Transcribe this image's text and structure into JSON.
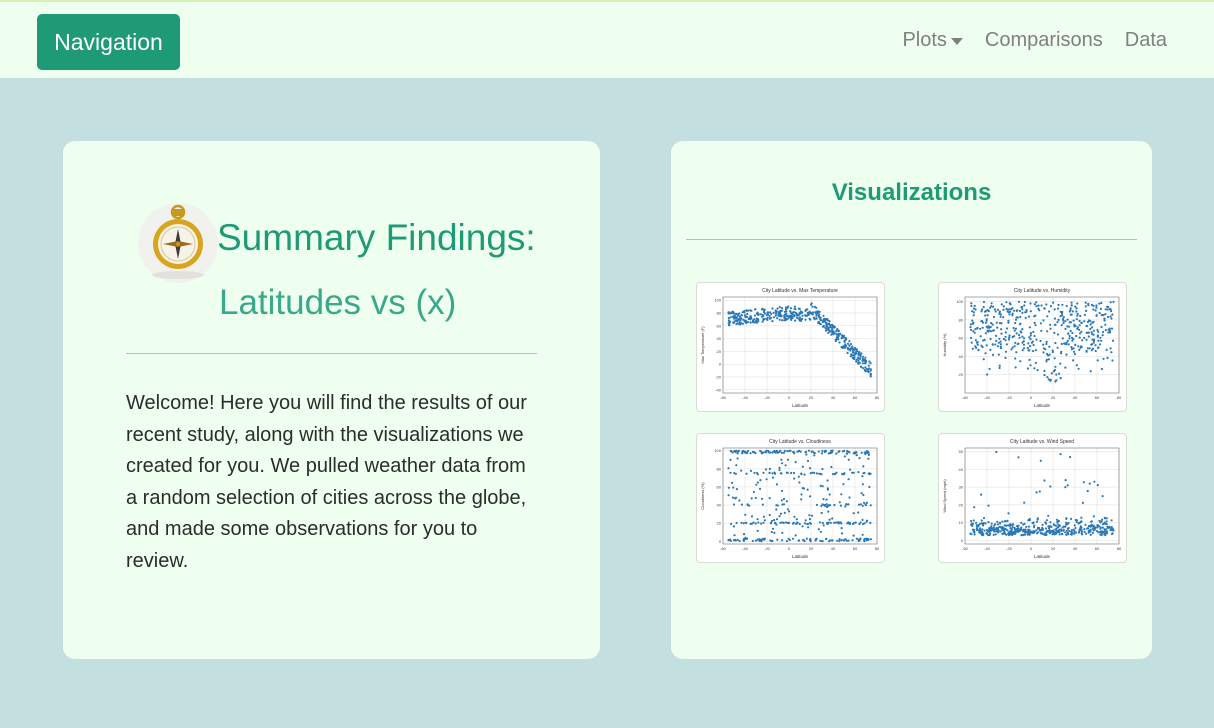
{
  "navbar": {
    "brand": "Navigation",
    "links": [
      {
        "label": "Plots",
        "has_dropdown": true
      },
      {
        "label": "Comparisons"
      },
      {
        "label": "Data"
      }
    ]
  },
  "summary": {
    "icon": "compass-icon",
    "title": "Summary Findings:",
    "subtitle": "Latitudes vs (x)",
    "body": "Welcome! Here you will find the results of our recent study, along with the visualizations we created for you. We pulled weather data from a random selection of cities across the globe, and made some observations for you to review."
  },
  "visualizations": {
    "title": "Visualizations",
    "accent_color": "#1f9a76",
    "point_color": "#2b78b7"
  },
  "chart_data": [
    {
      "type": "scatter",
      "title": "City Latitude vs. Max Temperature",
      "xlabel": "Latitude",
      "ylabel": "Max Temperature (F)",
      "xlim": [
        -60,
        80
      ],
      "ylim": [
        -45,
        105
      ],
      "xticks": [
        "-60",
        "-40",
        "-20",
        "0",
        "20",
        "40",
        "60",
        "80"
      ],
      "yticks": [
        "100",
        "80",
        "60",
        "40",
        "20",
        "0",
        "-20",
        "-40"
      ],
      "ytick_values": [
        100,
        80,
        60,
        40,
        20,
        0,
        -20,
        -40
      ],
      "pattern": "temp"
    },
    {
      "type": "scatter",
      "title": "City Latitude vs. Humidity",
      "xlabel": "Latitude",
      "ylabel": "Humidity (%)",
      "xlim": [
        -60,
        80
      ],
      "ylim": [
        0,
        105
      ],
      "xticks": [
        "-60",
        "-40",
        "-20",
        "0",
        "20",
        "40",
        "60",
        "80"
      ],
      "yticks": [
        "100",
        "80",
        "60",
        "40",
        "20"
      ],
      "ytick_values": [
        100,
        80,
        60,
        40,
        20
      ],
      "pattern": "humidity"
    },
    {
      "type": "scatter",
      "title": "City Latitude vs. Cloudiness",
      "xlabel": "Latitude",
      "ylabel": "Cloudiness (%)",
      "xlim": [
        -60,
        80
      ],
      "ylim": [
        -3,
        103
      ],
      "xticks": [
        "-60",
        "-40",
        "-20",
        "0",
        "20",
        "40",
        "60",
        "80"
      ],
      "yticks": [
        "100",
        "80",
        "60",
        "40",
        "20",
        "0"
      ],
      "ytick_values": [
        100,
        80,
        60,
        40,
        20,
        0
      ],
      "pattern": "cloud"
    },
    {
      "type": "scatter",
      "title": "City Latitude vs. Wind Speed",
      "xlabel": "Latitude",
      "ylabel": "Wind Speed (mph)",
      "xlim": [
        -60,
        80
      ],
      "ylim": [
        -2,
        52
      ],
      "xticks": [
        "-60",
        "-40",
        "-20",
        "0",
        "20",
        "40",
        "60",
        "80"
      ],
      "yticks": [
        "50",
        "40",
        "30",
        "20",
        "10",
        "0"
      ],
      "ytick_values": [
        50,
        40,
        30,
        20,
        10,
        0
      ],
      "pattern": "wind"
    }
  ]
}
